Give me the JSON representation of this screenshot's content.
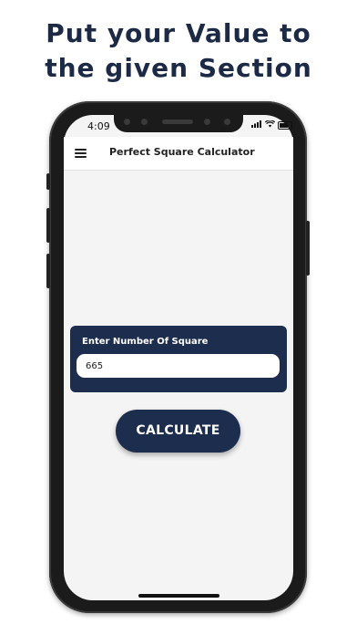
{
  "promo": {
    "line1": "Put your Value to",
    "line2": "the given Section"
  },
  "status_bar": {
    "time": "4:09"
  },
  "app_bar": {
    "title": "Perfect Square Calculator"
  },
  "form": {
    "label": "Enter Number Of Square",
    "value": "665"
  },
  "actions": {
    "calculate_label": "CALCULATE"
  },
  "colors": {
    "primary": "#1d2d4d",
    "headline": "#1c2a45",
    "screen_bg": "#f4f4f4"
  }
}
